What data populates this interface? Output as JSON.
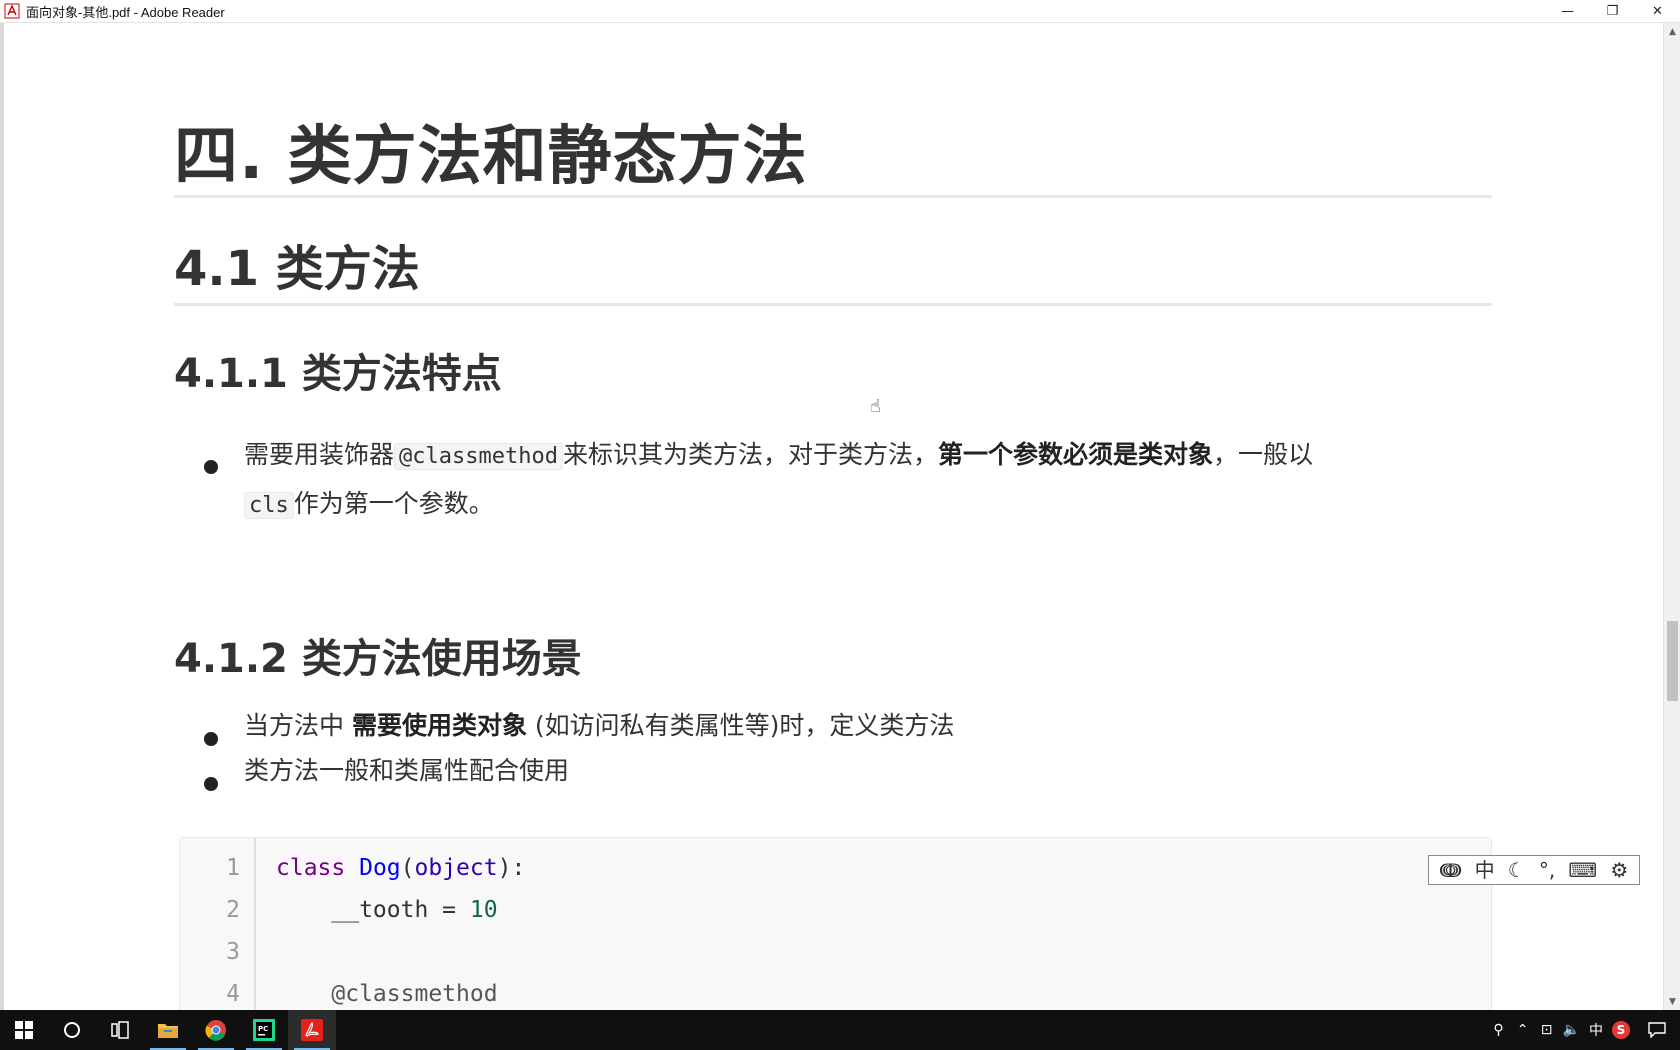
{
  "window": {
    "title": "面向对象-其他.pdf - Adobe Reader",
    "minimize": "—",
    "restore": "❐",
    "close": "✕"
  },
  "document": {
    "h1": "四. 类方法和静态方法",
    "h2": "4.1 类方法",
    "h3_features": "4.1.1 类方法特点",
    "feature_para": {
      "part1": "需要用装饰器",
      "code1": "@classmethod",
      "part2": "来标识其为类方法，对于类方法，",
      "bold": "第一个参数必须是类对象",
      "part3": "，一般以",
      "code2": "cls",
      "part4": "作为第一个参数。"
    },
    "h3_usage": "4.1.2 类方法使用场景",
    "usage_items": [
      {
        "pre": "当方法中 ",
        "bold": "需要使用类对象",
        "post": " (如访问私有类属性等)时，定义类方法"
      },
      {
        "pre": "类方法一般和类属性配合使用",
        "bold": "",
        "post": ""
      }
    ],
    "code": {
      "line_numbers": [
        "1",
        "2",
        "3",
        "4"
      ],
      "line1": {
        "kw": "class",
        "name": "Dog",
        "open": "(",
        "base": "object",
        "close": "):"
      },
      "line2": {
        "indent": "    ",
        "var": "__tooth",
        "op": " = ",
        "num": "10"
      },
      "line4": {
        "indent": "    ",
        "decorator": "@classmethod"
      }
    }
  },
  "ime_toolbar": {
    "items": [
      "ↈ",
      "中",
      "☾",
      "°,",
      "⌨",
      "⚙"
    ]
  },
  "taskbar": {
    "items": [
      "start",
      "search",
      "task-view",
      "file-explorer",
      "chrome",
      "pycharm",
      "adobe-reader"
    ],
    "tray": {
      "lang": "中",
      "s_label": "S"
    }
  }
}
